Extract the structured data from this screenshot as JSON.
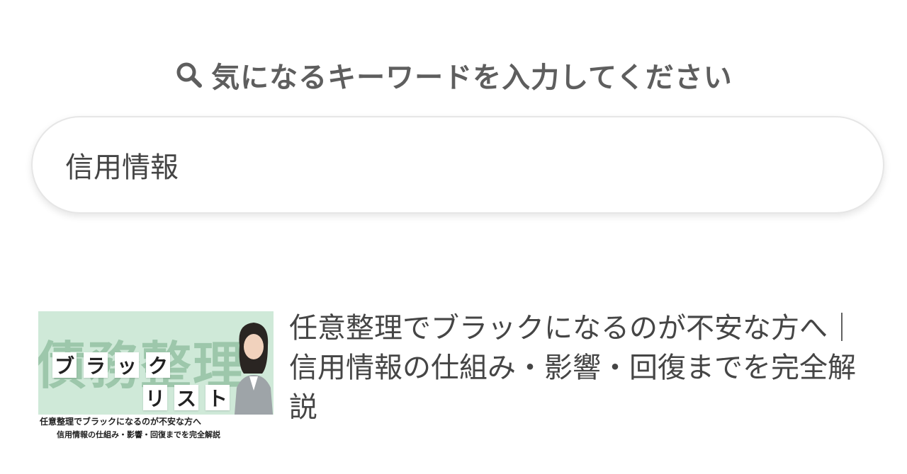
{
  "search": {
    "heading": "気になるキーワードを入力してください",
    "heading_icon": "search-icon",
    "value": "信用情報"
  },
  "results": [
    {
      "title": "任意整理でブラックになるのが不安な方へ｜信用情報の仕組み・影響・回復までを完全解説",
      "thumbnail": {
        "background_word": "債務整理",
        "word_row_1": [
          "ブ",
          "ラ",
          "ッ",
          "ク"
        ],
        "word_row_2": [
          "リ",
          "ス",
          "ト"
        ],
        "caption_1": "任意整理でブラックになるのが不安な方へ",
        "caption_2": "信用情報の仕組み・影響・回復までを完全解説"
      }
    }
  ]
}
